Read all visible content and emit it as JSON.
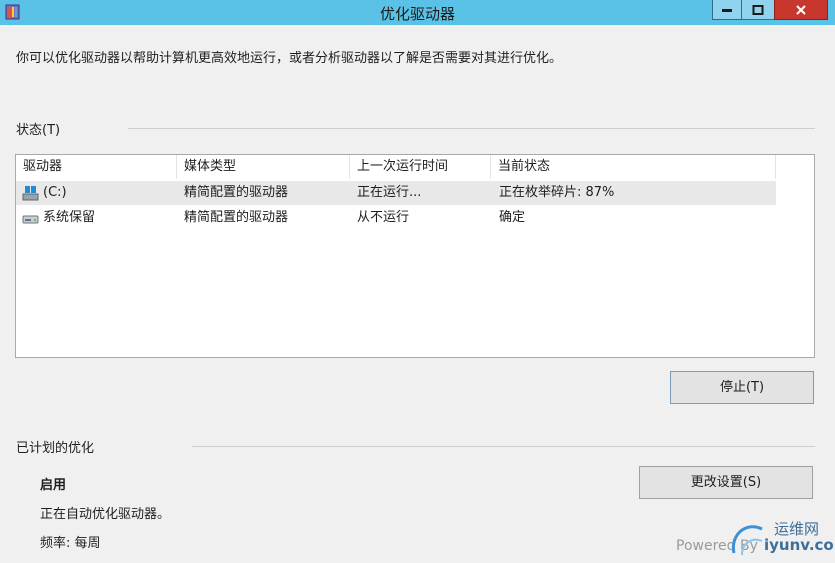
{
  "window": {
    "title": "优化驱动器",
    "colors": {
      "titlebar": "#5bc2e7",
      "close": "#c7372e"
    },
    "controls": [
      "minimize-icon",
      "maximize-icon",
      "close-icon"
    ]
  },
  "description": "你可以优化驱动器以帮助计算机更高效地运行，或者分析驱动器以了解是否需要对其进行优化。",
  "status": {
    "section_label": "状态(T)",
    "columns": [
      "驱动器",
      "媒体类型",
      "上一次运行时间",
      "当前状态"
    ],
    "rows": [
      {
        "icon": "windows-drive-icon",
        "drive": "(C:)",
        "media": "精简配置的驱动器",
        "last_run": "正在运行...",
        "status": "正在枚举碎片: 87%"
      },
      {
        "icon": "hard-drive-icon",
        "drive": "系统保留",
        "media": "精简配置的驱动器",
        "last_run": "从不运行",
        "status": "确定"
      }
    ],
    "stop_button": "停止(T)"
  },
  "scheduled": {
    "section_label": "已计划的优化",
    "state": "启用",
    "state_detail": "正在自动优化驱动器。",
    "frequency": "频率: 每周",
    "change_settings_button": "更改设置(S)"
  },
  "watermark": {
    "powered_by": "Powered By",
    "site_cn": "运维网",
    "site_en": "iyunv.com"
  }
}
